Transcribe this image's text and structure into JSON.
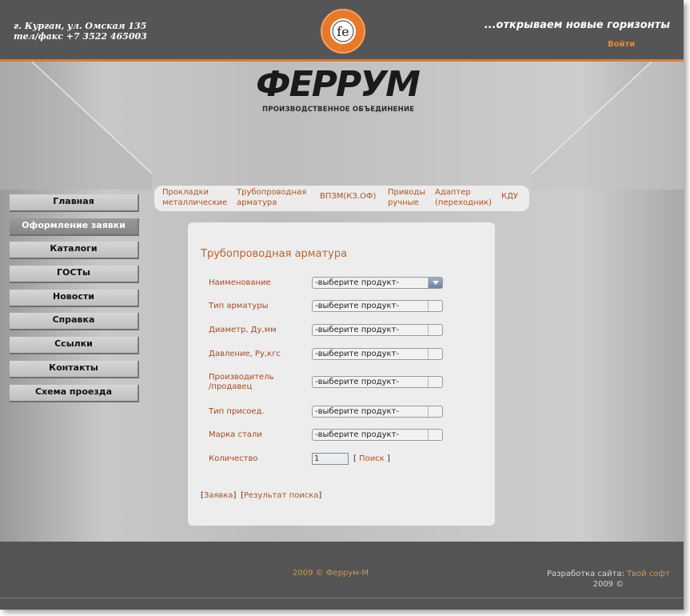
{
  "header": {
    "address_line1": "г. Курган, ул. Омская 135",
    "address_line2": "тел/факс +7 3522 465003",
    "slogan": "...открываем новые горизонты",
    "login_label": "Войти"
  },
  "brand": {
    "name": "ФЕРРУМ",
    "subtitle": "ПРОИЗВОДСТВЕННОЕ ОБЪЕДИНЕНИЕ",
    "logo_letters": "fe"
  },
  "sidebar": {
    "items": [
      {
        "label": "Главная"
      },
      {
        "label": "Оформление заявки"
      },
      {
        "label": "Каталоги"
      },
      {
        "label": "ГОСТы"
      },
      {
        "label": "Новости"
      },
      {
        "label": "Справка"
      },
      {
        "label": "Ссылки"
      },
      {
        "label": "Контакты"
      },
      {
        "label": "Схема проезда"
      }
    ]
  },
  "topnav": {
    "items": [
      {
        "line1": "Прокладки",
        "line2": "металлические"
      },
      {
        "line1": "Трубопроводная",
        "line2": "арматура"
      },
      {
        "line1": "ВПЗМ(КЗ.ОФ)",
        "line2": ""
      },
      {
        "line1": "Приводы",
        "line2": "ручные"
      },
      {
        "line1": "Адаптер",
        "line2": "(переходник)"
      },
      {
        "line1": "КДУ",
        "line2": ""
      }
    ]
  },
  "form": {
    "title": "Трубопроводная арматура",
    "fields": [
      {
        "label": "Наименование",
        "value": "-выберите продукт-"
      },
      {
        "label": "Тип арматуры",
        "value": "-выберите продукт-"
      },
      {
        "label": "Диаметр, Ду,мм",
        "value": "-выберите продукт-"
      },
      {
        "label": "Давление, Ру,кгс",
        "value": "-выберите продукт-"
      },
      {
        "label_line1": "Производитель",
        "label_line2": "/продавец",
        "value": "-выберите продукт-"
      },
      {
        "label": "Тип присоед.",
        "value": "-выберите продукт-"
      },
      {
        "label": "Марка стали",
        "value": "-выберите продукт-"
      }
    ],
    "quantity_label": "Количество",
    "quantity_value": "1",
    "search_label": "Поиск",
    "order_link": "Заявка",
    "results_link": "Результат поиска"
  },
  "footer": {
    "copyright": "2009 © Феррум-М",
    "dev_prefix": "Разработка сайта:",
    "dev_name": "Твой софт",
    "dev_year": "2009 ©"
  },
  "colors": {
    "accent": "#e07a2a",
    "link": "#b0521c",
    "header_bg": "#555555"
  }
}
